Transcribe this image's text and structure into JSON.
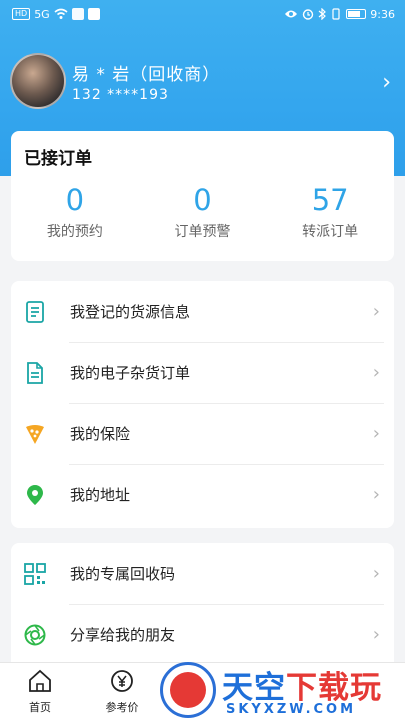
{
  "status_bar": {
    "carrier_chip": "HD",
    "signal": "5G",
    "time": "9:36"
  },
  "profile": {
    "name": "易 * 岩（回收商）",
    "phone": "132 ****193",
    "arrow": "›"
  },
  "orders": {
    "title": "已接订单",
    "stats": [
      {
        "value": "0",
        "label": "我的预约"
      },
      {
        "value": "0",
        "label": "订单预警"
      },
      {
        "value": "57",
        "label": "转派订单"
      }
    ]
  },
  "menu_group_1": [
    {
      "label": "我登记的货源信息",
      "icon": "document-list-icon"
    },
    {
      "label": "我的电子杂货订单",
      "icon": "file-icon"
    },
    {
      "label": "我的保险",
      "icon": "pizza-shield-icon"
    },
    {
      "label": "我的地址",
      "icon": "location-pin-icon"
    }
  ],
  "menu_group_2": [
    {
      "label": "我的专属回收码",
      "icon": "qr-code-icon"
    },
    {
      "label": "分享给我的朋友",
      "icon": "share-aperture-icon"
    }
  ],
  "tabbar": {
    "home": "首页",
    "price": "参考价"
  },
  "watermark": {
    "title_part1": "天空",
    "title_part2": "下载玩",
    "url": "SKYXZW.COM"
  },
  "colors": {
    "header_blue": "#34a6ee",
    "stat_blue": "#2fa4e7",
    "icon_teal": "#1aa5a5",
    "icon_orange": "#f5a623",
    "icon_green": "#2eb84a"
  }
}
